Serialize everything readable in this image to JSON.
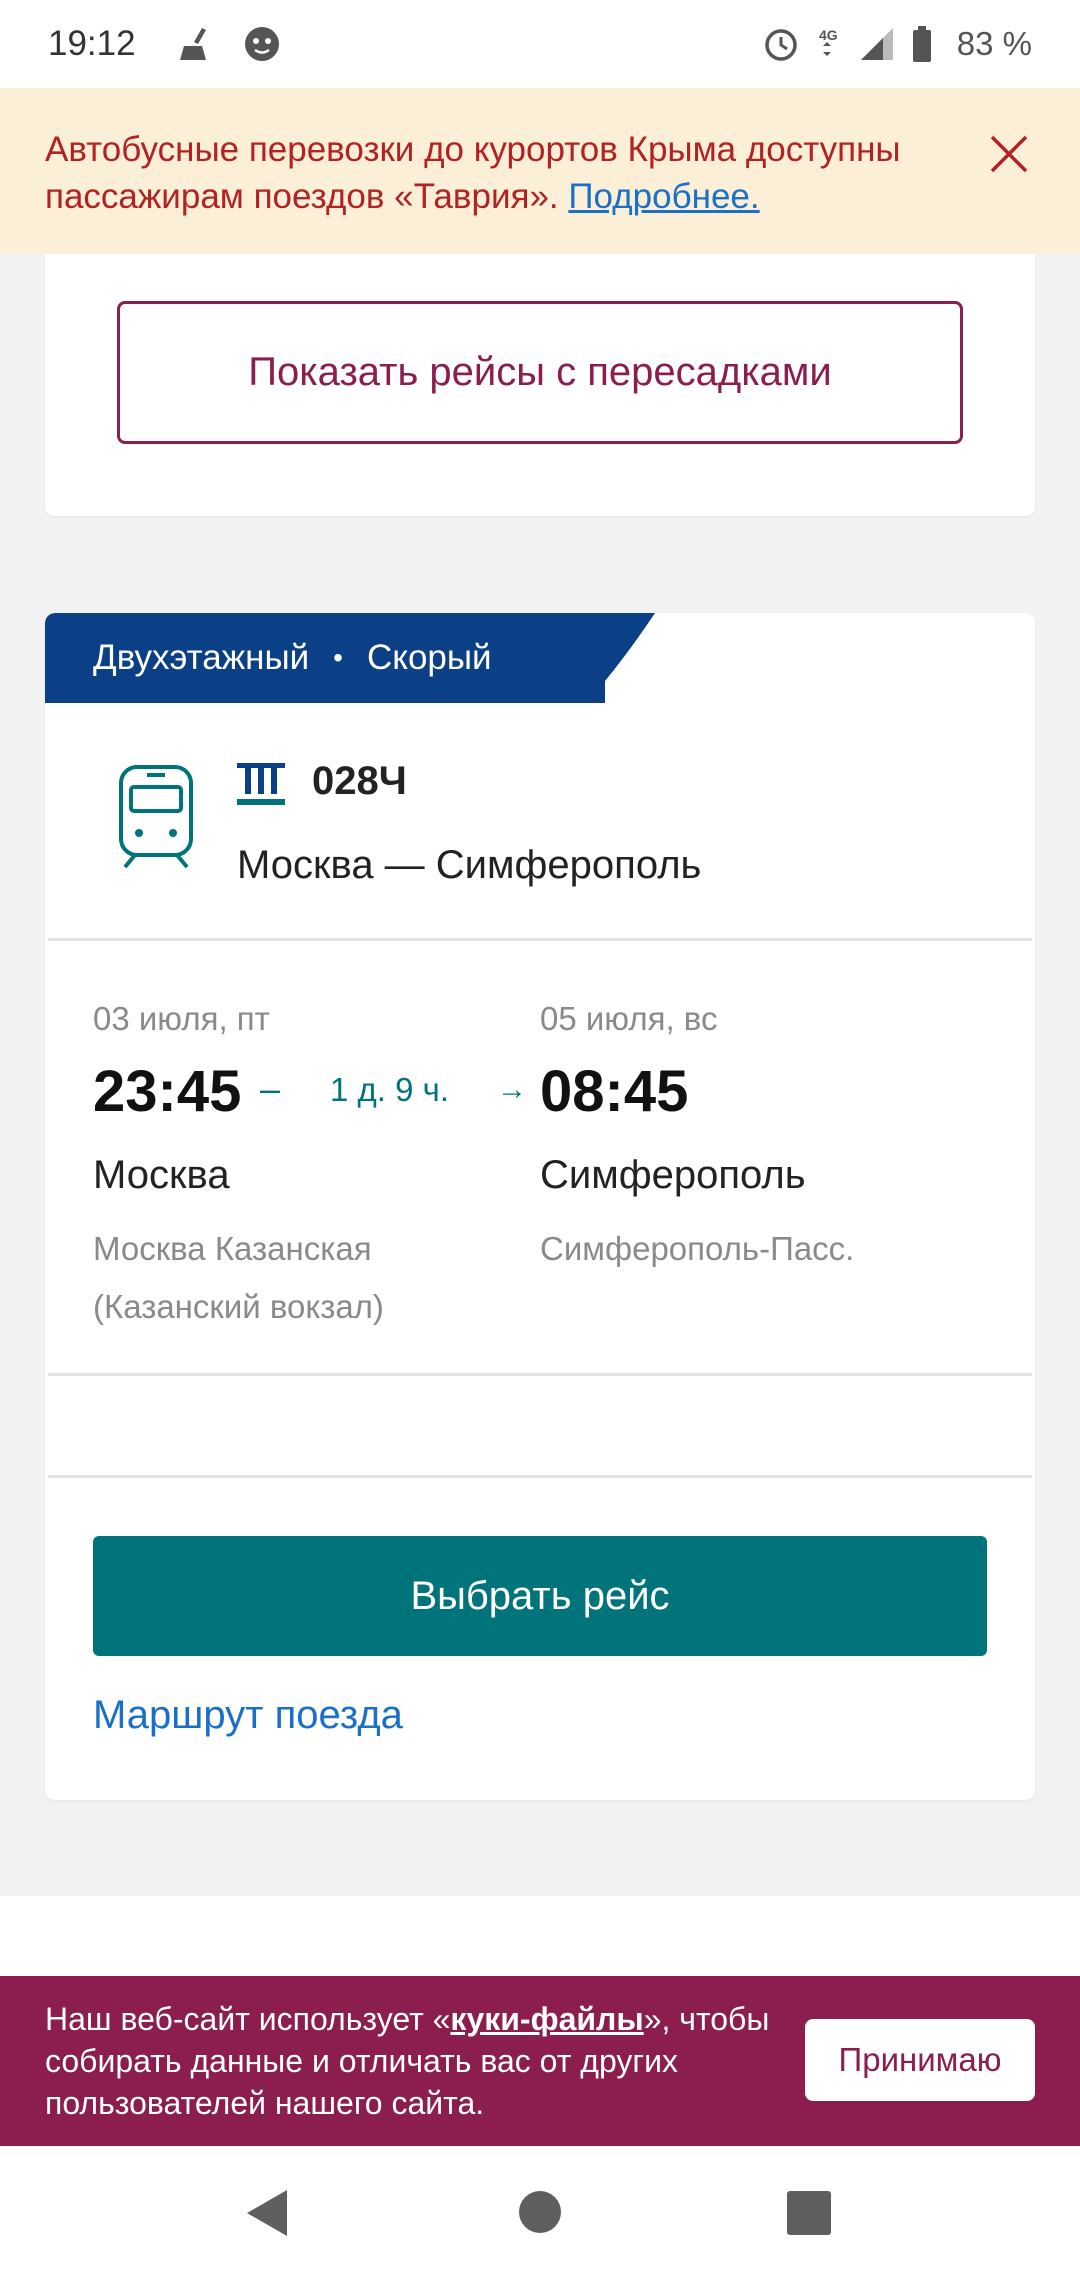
{
  "status_bar": {
    "time": "19:12",
    "battery": "83 %",
    "icons": [
      "broom-icon",
      "shield-icon",
      "alarm-icon",
      "network-4g-icon",
      "signal-icon",
      "battery-icon"
    ]
  },
  "notice": {
    "text": "Автобусные перевозки до курортов Крыма доступны пассажирам поездов «Таврия». ",
    "link": "Подробнее."
  },
  "transfers_button": "Показать рейсы с пересадками",
  "train": {
    "tag_type": "Двухэтажный",
    "tag_dot": "•",
    "tag_speed": "Скорый",
    "number": "028Ч",
    "route": "Москва — Симферополь",
    "departure": {
      "date": "03 июля, пт",
      "time": "23:45",
      "city": "Москва",
      "station": "Москва Казанская (Казанский вокзал)"
    },
    "dash": "–",
    "duration": "1 д. 9 ч.",
    "arrow": "→",
    "arrival": {
      "date": "05 июля, вс",
      "time": "08:45",
      "city": "Симферополь",
      "station": "Симферополь-Пасс."
    },
    "select_button": "Выбрать рейс",
    "route_link": "Маршрут поезда"
  },
  "cookie": {
    "text_before": "Наш веб-сайт использует «",
    "link": "куки-файлы",
    "text_after": "», чтобы собирать данные и отличать вас от других пользователей нашего сайта.",
    "accept_button": "Принимаю"
  },
  "colors": {
    "brand": "#8b1d4f",
    "accent": "#00747a",
    "tag_blue": "#0b3f86",
    "notice_bg": "#fcefd7",
    "notice_text": "#b22222",
    "link": "#1a6fc9"
  }
}
